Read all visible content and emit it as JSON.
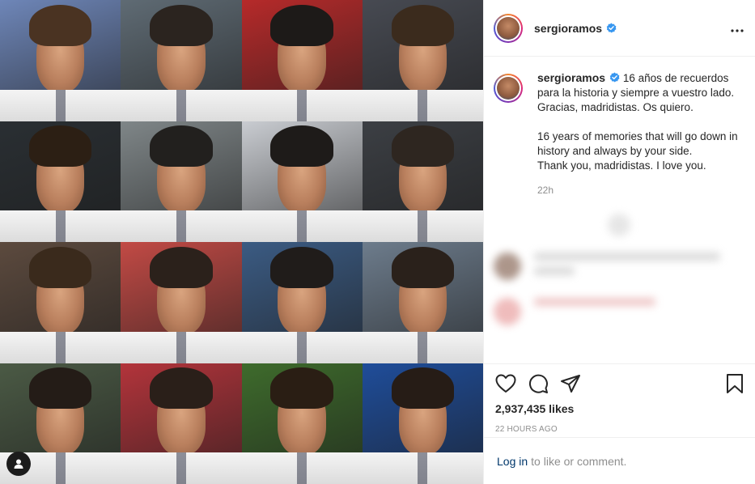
{
  "post": {
    "username": "sergioramos",
    "verified_icon": "verified-badge-icon",
    "more_icon": "more-options-icon"
  },
  "caption": {
    "username": "sergioramos",
    "text": "16 años de recuerdos para la historia y siempre a vuestro lado.\nGracias, madridistas. Os quiero.\n\n16 years of memories that will go down in history and always by your side.\nThank you, madridistas. I love you.",
    "time": "22h"
  },
  "engagement": {
    "likes": "2,937,435 likes",
    "posted": "22 HOURS AGO"
  },
  "login_prompt": {
    "link": "Log in",
    "rest": "to like or comment."
  },
  "icons": {
    "like": "heart-icon",
    "comment": "comment-icon",
    "share": "share-icon",
    "save": "bookmark-icon",
    "tagged_user": "user-tag-icon"
  },
  "colors": {
    "accent_link": "#00376b",
    "verified_blue": "#3897f0",
    "secondary_text": "#8e8e8e",
    "border": "#efefef"
  },
  "media": {
    "tiles": [
      {
        "bg": "#6e86b8",
        "hair": "#4a3322"
      },
      {
        "bg": "#5f6b74",
        "hair": "#2b241f"
      },
      {
        "bg": "#b62a2a",
        "hair": "#1d1a18"
      },
      {
        "bg": "#474a52",
        "hair": "#3b2b1d"
      },
      {
        "bg": "#2a2f33",
        "hair": "#2c1f14"
      },
      {
        "bg": "#7f8688",
        "hair": "#22201e"
      },
      {
        "bg": "#c9ccd1",
        "hair": "#1e1b19"
      },
      {
        "bg": "#3c3f44",
        "hair": "#2e2620"
      },
      {
        "bg": "#5c4a3e",
        "hair": "#3a2a1c"
      },
      {
        "bg": "#c24a45",
        "hair": "#2b211b"
      },
      {
        "bg": "#3b5b83",
        "hair": "#201c1a"
      },
      {
        "bg": "#6d7c8c",
        "hair": "#2a211b"
      },
      {
        "bg": "#4b5a45",
        "hair": "#241c17"
      },
      {
        "bg": "#b3343b",
        "hair": "#2a1f19"
      },
      {
        "bg": "#3e6b2c",
        "hair": "#2a1e14"
      },
      {
        "bg": "#1f4d9a",
        "hair": "#261c16"
      }
    ]
  }
}
